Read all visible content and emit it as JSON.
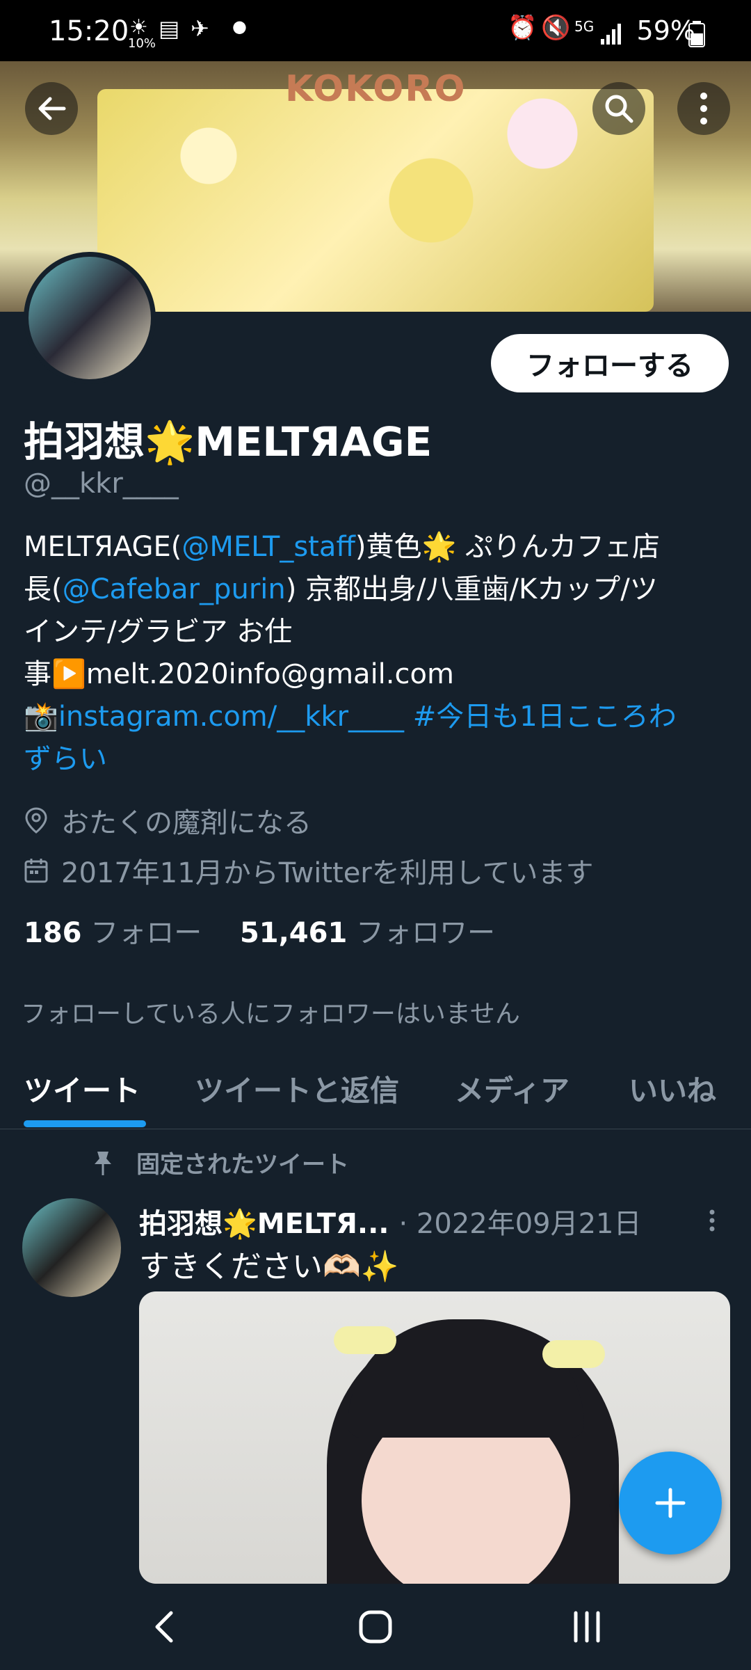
{
  "status": {
    "time": "15:20",
    "weather": "10%",
    "network": "5G",
    "battery": "59%"
  },
  "banner": {
    "sign_text": "KOKORO"
  },
  "profile": {
    "follow_label": "フォローする",
    "name": "拍羽想🌟MELTЯAGE",
    "handle": "@__kkr____",
    "bio_line1_a": "MELTЯAGE(",
    "bio_line1_link": "@MELT_staff",
    "bio_line1_b": ")黄色🌟 ぷりんカフェ店",
    "bio_line2_a": "長(",
    "bio_line2_link": "@Cafebar_purin",
    "bio_line2_b": ") 京都出身/八重歯/Kカップ/ツ",
    "bio_line3": "インテ/グラビア お仕",
    "bio_line4": "事▶️melt.2020info@gmail.com",
    "bio_line5_icon": "📸",
    "bio_line5_link": "instagram.com/__kkr____",
    "bio_line5_tag": "#今日も1日こころわ",
    "bio_line6_tag": "ずらい",
    "location": "おたくの魔剤になる",
    "joined": "2017年11月からTwitterを利用しています",
    "following_count": "186",
    "following_label": "フォロー",
    "followers_count": "51,461",
    "followers_label": "フォロワー",
    "no_mutual": "フォローしている人にフォロワーはいません"
  },
  "tabs": [
    {
      "label": "ツイート"
    },
    {
      "label": "ツイートと返信"
    },
    {
      "label": "メディア"
    },
    {
      "label": "いいね"
    }
  ],
  "tweet": {
    "pinned_label": "固定されたツイート",
    "author": "拍羽想🌟MELTЯ...",
    "date": "· 2022年09月21日",
    "text": "すきください🫶🏻✨"
  },
  "colors": {
    "background": "#15202b",
    "accent": "#1d9bf0",
    "muted": "#8b98a5"
  }
}
